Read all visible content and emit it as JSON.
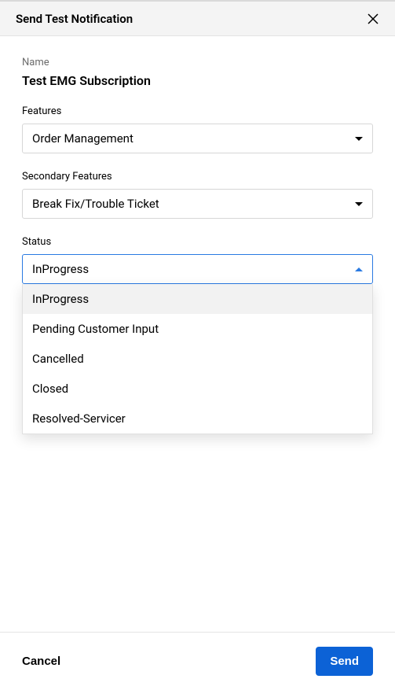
{
  "header": {
    "title": "Send Test Notification"
  },
  "fields": {
    "name_label": "Name",
    "name_value": "Test EMG Subscription",
    "features_label": "Features",
    "features_value": "Order Management",
    "secondary_features_label": "Secondary Features",
    "secondary_features_value": "Break Fix/Trouble Ticket",
    "status_label": "Status",
    "status_value": "InProgress",
    "status_options": [
      "InProgress",
      "Pending Customer Input",
      "Cancelled",
      "Closed",
      "Resolved-Servicer"
    ]
  },
  "footer": {
    "cancel_label": "Cancel",
    "send_label": "Send"
  }
}
